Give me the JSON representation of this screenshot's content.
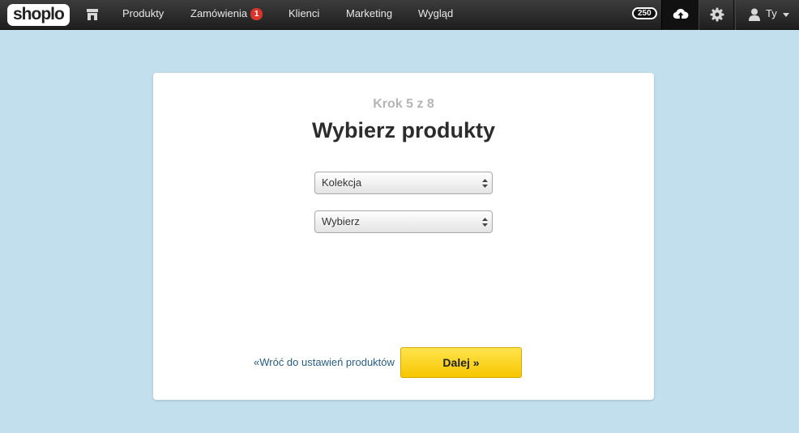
{
  "topbar": {
    "logo": "shoplo",
    "nav": [
      {
        "label": "Produkty"
      },
      {
        "label": "Zamówienia",
        "badge": "1"
      },
      {
        "label": "Klienci"
      },
      {
        "label": "Marketing"
      },
      {
        "label": "Wygląd"
      }
    ],
    "credits": "250",
    "user_label": "Ty",
    "icons": [
      "store-icon",
      "cloud-upload-icon",
      "gear-icon",
      "user-icon",
      "caret-down-icon"
    ]
  },
  "wizard": {
    "step": "Krok 5 z 8",
    "title": "Wybierz produkty",
    "select_collection": "Kolekcja",
    "select_choose": "Wybierz",
    "back_link": "«Wróć do ustawień produktów",
    "next_button": "Dalej »"
  },
  "colors": {
    "page_background": "#c2dfee",
    "topbar": "#2a2a2a",
    "badge": "#d9352a",
    "primary_button": "#f9cf1c",
    "link": "#2a5d84"
  }
}
